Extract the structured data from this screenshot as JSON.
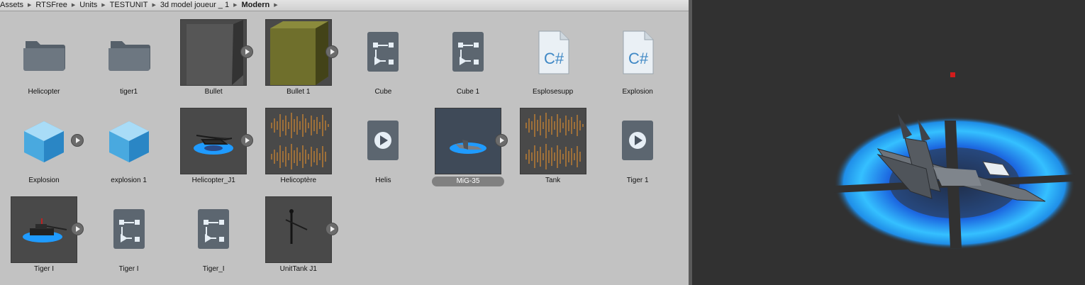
{
  "breadcrumb": [
    "Assets",
    "RTSFree",
    "Units",
    "TESTUNIT",
    "3d model joueur _ 1",
    "Modern"
  ],
  "assets": [
    {
      "label": "Helicopter",
      "icon": "folder-icon",
      "type": "folder"
    },
    {
      "label": "tiger1",
      "icon": "folder-icon",
      "type": "folder"
    },
    {
      "label": "Bullet",
      "icon": "gray-cube-thumbnail",
      "type": "model"
    },
    {
      "label": "Bullet 1",
      "icon": "olive-cube-thumbnail",
      "type": "model"
    },
    {
      "label": "Cube",
      "icon": "animator-controller-icon",
      "type": "controller"
    },
    {
      "label": "Cube 1",
      "icon": "animator-controller-icon",
      "type": "controller"
    },
    {
      "label": "Esplosesupp",
      "icon": "csharp-script-icon",
      "type": "script"
    },
    {
      "label": "Explosion",
      "icon": "csharp-script-icon",
      "type": "script"
    },
    {
      "label": "Explosion",
      "icon": "prefab-icon",
      "type": "prefab"
    },
    {
      "label": "explosion 1",
      "icon": "prefab-icon",
      "type": "prefab"
    },
    {
      "label": "Helicopter_J1",
      "icon": "helicopter-thumbnail",
      "type": "model"
    },
    {
      "label": "Helicoptère",
      "icon": "audio-waveform-thumbnail",
      "type": "audio"
    },
    {
      "label": "Helis",
      "icon": "animation-clip-icon",
      "type": "animation"
    },
    {
      "label": "MiG-35",
      "icon": "jet-thumbnail",
      "type": "model",
      "selected": true
    },
    {
      "label": "Tank",
      "icon": "audio-waveform-thumbnail",
      "type": "audio"
    },
    {
      "label": "Tiger 1",
      "icon": "animation-clip-icon",
      "type": "animation"
    },
    {
      "label": "Tiger I",
      "icon": "tank-thumbnail",
      "type": "model"
    },
    {
      "label": "Tiger I",
      "icon": "animator-controller-icon",
      "type": "controller"
    },
    {
      "label": "Tiger_I",
      "icon": "animator-controller-icon",
      "type": "controller"
    },
    {
      "label": "UnitTank J1",
      "icon": "soldier-thumbnail",
      "type": "model"
    }
  ],
  "colors": {
    "panel": "#c2c2c2",
    "scene": "#313131",
    "selection": "#808080",
    "audio": "#d6892f",
    "ring": "#1f9bff"
  }
}
